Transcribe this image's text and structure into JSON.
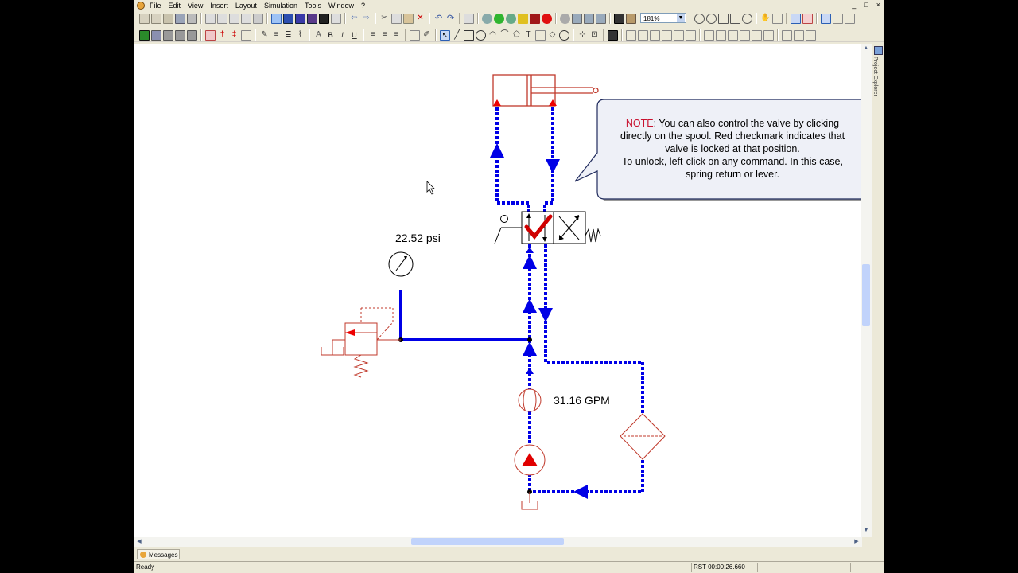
{
  "menubar": {
    "items": [
      "File",
      "Edit",
      "View",
      "Insert",
      "Layout",
      "Simulation",
      "Tools",
      "Window",
      "?"
    ],
    "window_controls": [
      "_",
      "□",
      "×"
    ]
  },
  "toolbar": {
    "zoom": "181%"
  },
  "side_panel": {
    "label": "Project Explorer"
  },
  "diagram": {
    "pressure_reading": "22.52 psi",
    "flow_reading": "31.16 GPM"
  },
  "note": {
    "label": "NOTE",
    "line1_rest": ": You can also control the valve by clicking",
    "line2": "directly on the spool. Red checkmark indicates that",
    "line3": "valve is locked at that position.",
    "line4": "To unlock, left-click on any command. In this case,",
    "line5": "spring return or lever."
  },
  "bottom": {
    "messages_tab": "Messages"
  },
  "status": {
    "ready": "Ready",
    "timer": "RST 00:00:26.660"
  },
  "colors": {
    "flow_blue": "#0000e6",
    "component_red": "#c0392b",
    "alert_red": "#d00000"
  }
}
